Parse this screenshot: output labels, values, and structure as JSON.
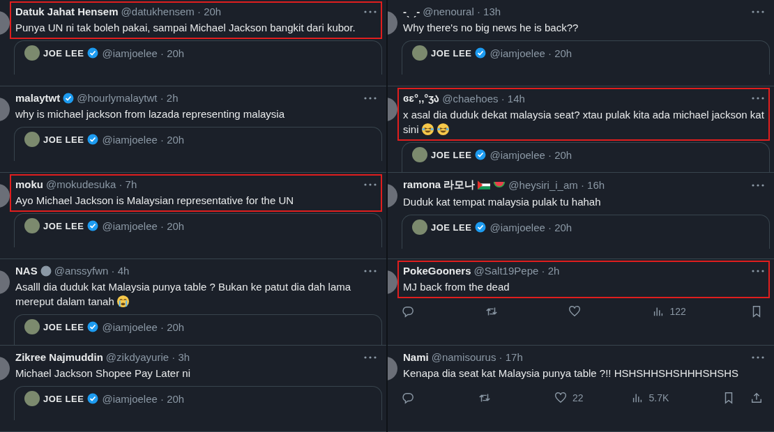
{
  "columns": [
    {
      "tweets": [
        {
          "name": "Datuk Jahat Hensem",
          "meta": "@datukhensem · 20h",
          "text": "Punya UN ni tak boleh pakai, sampai Michael Jackson bangkit dari kubor.",
          "highlighted": true,
          "quote": {
            "name": "JOE LEE",
            "verified": true,
            "meta": "@iamjoelee · 20h"
          }
        },
        {
          "name": "malaytwt",
          "verified": true,
          "meta": "@hourlymalaytwt · 2h",
          "text": "why is michael jackson from lazada representing malaysia",
          "highlighted": false,
          "quote": {
            "name": "JOE LEE",
            "verified": true,
            "meta": "@iamjoelee · 20h"
          }
        },
        {
          "name": "moku",
          "meta": "@mokudesuka · 7h",
          "text": "Ayo Michael Jackson is Malaysian representative for the UN",
          "highlighted": true,
          "quote": {
            "name": "JOE LEE",
            "verified": true,
            "meta": "@iamjoelee · 20h"
          }
        },
        {
          "name": "NAS",
          "label_badge": true,
          "meta": "@anssyfwn · 4h",
          "text": "Asalll dia duduk kat Malaysia punya table ? Bukan ke patut dia dah lama mereput dalam tanah",
          "emojis": [
            {
              "kind": "crying"
            }
          ],
          "highlighted": false,
          "quote": {
            "name": "JOE LEE",
            "verified": true,
            "meta": "@iamjoelee · 20h"
          }
        },
        {
          "name": "Zikree Najmuddin",
          "meta": "@zikdyayurie · 3h",
          "text": "Michael Jackson Shopee Pay Later ni",
          "highlighted": false,
          "quote": {
            "name": "JOE LEE",
            "verified": true,
            "meta": "@iamjoelee · 20h"
          }
        }
      ]
    },
    {
      "tweets": [
        {
          "name": "-ˎ          ˏ-",
          "meta": "@nenoural · 13h",
          "text": "Why there's no big news he is back??",
          "highlighted": false,
          "quote": {
            "name": "JOE LEE",
            "verified": true,
            "meta": "@iamjoelee · 20h"
          }
        },
        {
          "name": "ɞɛ°‚‚°ʒა",
          "meta": "@chaehoes · 14h",
          "text": "x asal dia duduk dekat malaysia seat? xtau pulak kita ada michael jackson kat sini",
          "emojis": [
            {
              "kind": "laughing"
            },
            {
              "kind": "laughing"
            }
          ],
          "highlighted": true,
          "quote": {
            "name": "JOE LEE",
            "verified": true,
            "meta": "@iamjoelee · 20h"
          }
        },
        {
          "name": "ramona 라모나",
          "name_icons": [
            {
              "kind": "flag"
            },
            {
              "kind": "watermelon"
            }
          ],
          "meta": "@heysiri_i_am · 16h",
          "text": "Duduk kat tempat malaysia pulak tu hahah",
          "highlighted": false,
          "quote": {
            "name": "JOE LEE",
            "verified": true,
            "meta": "@iamjoelee · 20h"
          }
        },
        {
          "name": "PokeGooners",
          "meta": "@Salt19Pepe · 2h",
          "text": "MJ back from the dead",
          "highlighted": true,
          "actions": [
            {
              "kind": "reply"
            },
            {
              "kind": "retweet"
            },
            {
              "kind": "like"
            },
            {
              "kind": "views",
              "count": "122"
            },
            {
              "kind": "bookmark"
            }
          ]
        },
        {
          "name": "Nami",
          "meta": "@namisourus · 17h",
          "text": "Kenapa dia seat kat Malaysia punya table ?!! HSHSHHSHSHHHSHSHS",
          "highlighted": false,
          "actions": [
            {
              "kind": "reply"
            },
            {
              "kind": "retweet"
            },
            {
              "kind": "like",
              "count": "22"
            },
            {
              "kind": "views",
              "count": "5.7K"
            },
            {
              "kind": "bookmark"
            },
            {
              "kind": "share"
            }
          ]
        }
      ]
    }
  ]
}
